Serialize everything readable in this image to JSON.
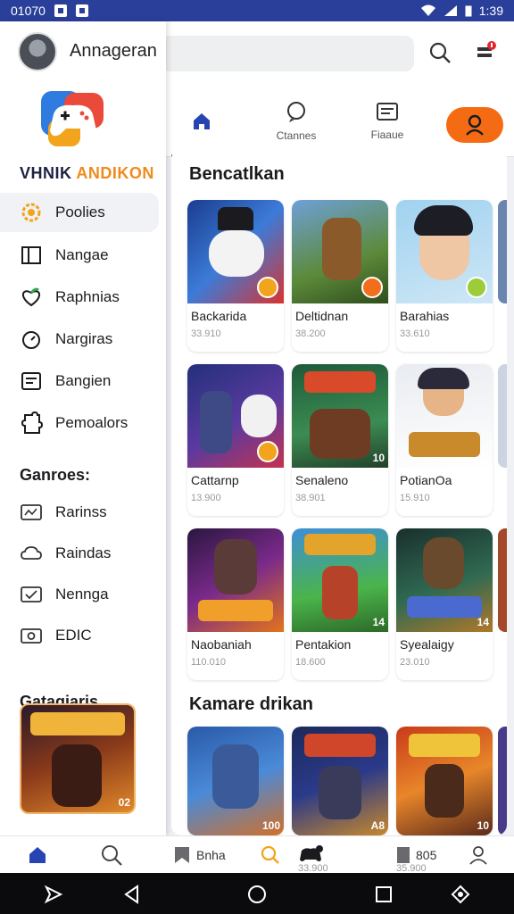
{
  "status_bar": {
    "time_left": "01070",
    "time_right": "1:39"
  },
  "drawer": {
    "username": "Annageran",
    "brand_part1": "VHNIK ",
    "brand_part2": "ANDIKON",
    "nav": [
      {
        "label": "Poolies",
        "icon": "gear-icon"
      },
      {
        "label": "Nangae",
        "icon": "tablet-icon"
      },
      {
        "label": "Raphnias",
        "icon": "heart-icon"
      },
      {
        "label": "Nargiras",
        "icon": "timer-icon"
      },
      {
        "label": "Bangien",
        "icon": "document-icon"
      },
      {
        "label": "Pemoalors",
        "icon": "puzzle-icon"
      }
    ],
    "games_heading": "Ganroes:",
    "games": [
      {
        "label": "Rarinss",
        "icon": "chart-icon"
      },
      {
        "label": "Raindas",
        "icon": "cloud-icon"
      },
      {
        "label": "Nennga",
        "icon": "check-icon"
      },
      {
        "label": "EDIC",
        "icon": "camera-icon"
      }
    ],
    "categories_heading": "Gatagiaris",
    "category_badge": "02"
  },
  "tabs": [
    {
      "label": "",
      "icon": "home-icon"
    },
    {
      "label": "Ctannes",
      "icon": "chat-icon"
    },
    {
      "label": "Fiaaue",
      "icon": "news-icon"
    }
  ],
  "content": {
    "section1_title": "Bencatlkan",
    "section2_title": "Kamare drikan",
    "rows": [
      [
        {
          "name": "Backarida",
          "sub": "33.910"
        },
        {
          "name": "Deltidnan",
          "sub": "38.200"
        },
        {
          "name": "Barahias",
          "sub": "33.610"
        }
      ],
      [
        {
          "name": "Cattarnp",
          "sub": "13.900"
        },
        {
          "name": "Senaleno",
          "sub": "38.901",
          "badge": "10"
        },
        {
          "name": "PotianOa",
          "sub": "15.910"
        }
      ],
      [
        {
          "name": "Naobaniah",
          "sub": "110.010",
          "badge": ""
        },
        {
          "name": "Pentakion",
          "sub": "18.600",
          "badge": "14"
        },
        {
          "name": "Syealaigy",
          "sub": "23.010",
          "badge": "14"
        }
      ]
    ],
    "row4_badges": [
      "100",
      "A8",
      "10"
    ]
  },
  "bottom_bar": {
    "item1": "Bnha",
    "item1_sub": "",
    "item2_sub": "33.900",
    "item3": "805",
    "item3_sub": "35.900"
  },
  "colors": {
    "primary": "#2844b2",
    "accent": "#f56b13",
    "status_bar": "#2a3f9a"
  }
}
